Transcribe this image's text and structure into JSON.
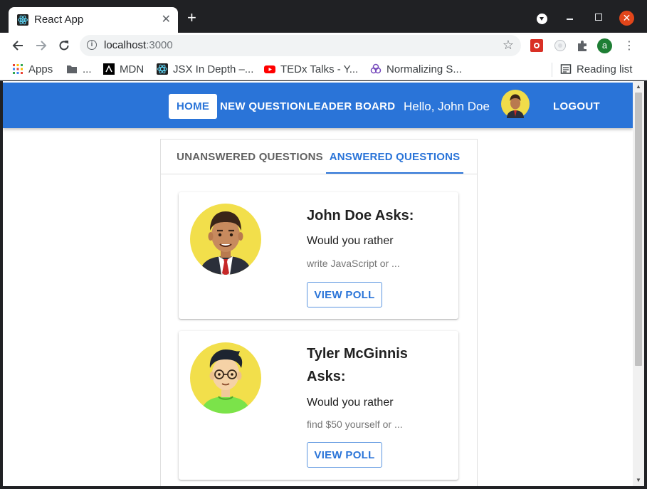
{
  "browser": {
    "tab_title": "React App",
    "tab_close": "✕",
    "new_tab": "+",
    "url_host": "localhost",
    "url_port": ":3000",
    "profile_letter": "a",
    "bookmarks": [
      {
        "label": "Apps",
        "icon": "apps-grid-icon"
      },
      {
        "label": "...",
        "icon": "folder-icon"
      },
      {
        "label": "MDN",
        "icon": "mdn-icon"
      },
      {
        "label": "JSX In Depth –...",
        "icon": "react-icon"
      },
      {
        "label": "TEDx Talks - Y...",
        "icon": "youtube-icon"
      },
      {
        "label": "Normalizing S...",
        "icon": "redux-icon"
      }
    ],
    "reading_list": "Reading list"
  },
  "appbar": {
    "nav": [
      "Home",
      "New Question",
      "Leader Board"
    ],
    "active_nav": "Home",
    "greeting": "Hello, John Doe",
    "logout": "Logout",
    "color": "#2a74d8"
  },
  "tabs": {
    "items": [
      "UNANSWERED QUESTIONS",
      "ANSWERED QUESTIONS"
    ],
    "selected": "ANSWERED QUESTIONS"
  },
  "questions": [
    {
      "asker": "John Doe Asks:",
      "prompt": "Would you rather",
      "preview": "write JavaScript or ...",
      "button": "VIEW POLL"
    },
    {
      "asker": "Tyler McGinnis Asks:",
      "prompt": "Would you rather",
      "preview": "find $50 yourself or ...",
      "button": "VIEW POLL"
    }
  ]
}
